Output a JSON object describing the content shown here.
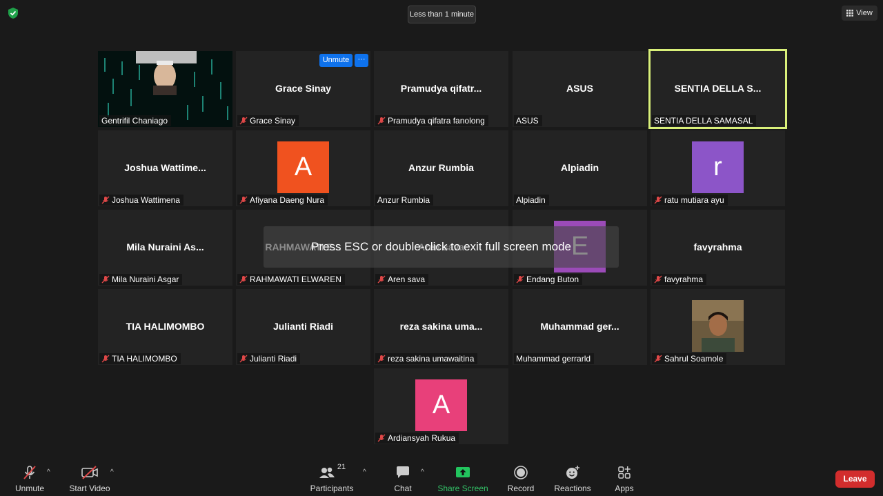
{
  "top": {
    "timer": "Less than 1 minute",
    "view_label": "View"
  },
  "overlay": {
    "esc_message": "Press ESC or double-click to exit full screen mode"
  },
  "tiles": [
    {
      "name": "Gentrifil Chaniago",
      "type": "video"
    },
    {
      "name": "Grace Sinay",
      "display": "Grace Sinay",
      "muted": true,
      "unmute_label": "Unmute",
      "more_label": "···"
    },
    {
      "name": "Pramudya qifatra fanolong",
      "display": "Pramudya  qifatr...",
      "muted": true
    },
    {
      "name": "ASUS",
      "display": "ASUS",
      "muted": false
    },
    {
      "name": "SENTIA DELLA SAMASAL",
      "display": "SENTIA DELLA S...",
      "muted": false,
      "speaking": true
    },
    {
      "name": "Joshua Wattimena",
      "display": "Joshua  Wattime...",
      "muted": true
    },
    {
      "name": "Afiyana Daeng Nura",
      "avatar": "A",
      "avatar_color": "#f0521f",
      "muted": true
    },
    {
      "name": "Anzur Rumbia",
      "display": "Anzur Rumbia",
      "muted": false
    },
    {
      "name": "Alpiadin",
      "display": "Alpiadin",
      "muted": false
    },
    {
      "name": "ratu mutiara ayu",
      "avatar": "r",
      "avatar_color": "#8c55c8",
      "muted": true
    },
    {
      "name": "Mila Nuraini Asgar",
      "display": "Mila Nuraini  As...",
      "muted": true
    },
    {
      "name": "RAHMAWATI ELWAREN",
      "display": "RAHMAWATI E...",
      "muted": true
    },
    {
      "name": "Aren sava",
      "display": "Aren sava",
      "muted": true
    },
    {
      "name": "Endang Buton",
      "avatar": "E",
      "avatar_color": "#9b4bb8",
      "muted": true
    },
    {
      "name": "favyrahma",
      "display": "favyrahma",
      "muted": true
    },
    {
      "name": "TIA HALIMOMBO",
      "display": "TIA HALIMOMBO",
      "muted": true
    },
    {
      "name": "Julianti Riadi",
      "display": "Julianti Riadi",
      "muted": true
    },
    {
      "name": "reza sakina umawaitina",
      "display": "reza sakina  uma...",
      "muted": true
    },
    {
      "name": "Muhammad gerrarld",
      "display": "Muhammad  ger...",
      "muted": false
    },
    {
      "name": "Sahrul Soamole",
      "type": "photo",
      "muted": true
    },
    {
      "name": "Ardiansyah Rukua",
      "avatar": "A",
      "avatar_color": "#e8407a",
      "muted": true
    }
  ],
  "toolbar": {
    "unmute": "Unmute",
    "start_video": "Start Video",
    "participants": "Participants",
    "participants_count": "21",
    "chat": "Chat",
    "share_screen": "Share Screen",
    "record": "Record",
    "reactions": "Reactions",
    "apps": "Apps",
    "leave": "Leave"
  },
  "colors": {
    "accent_blue": "#0e72ed",
    "share_green": "#22c55e",
    "leave_red": "#d22d2d",
    "speaking_outline": "#d9f07a"
  }
}
